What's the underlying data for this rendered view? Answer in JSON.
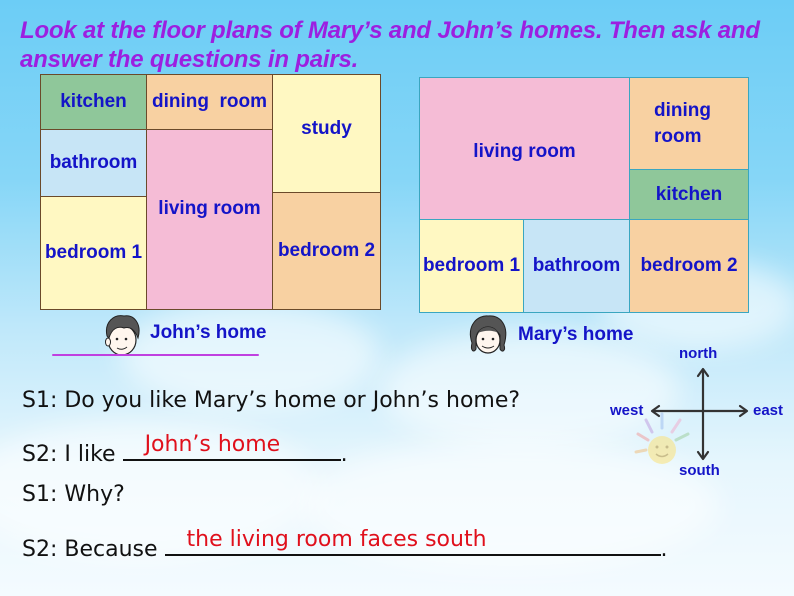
{
  "title": "Look at the floor plans of Mary’s and John’s homes. Then ask and answer the questions in pairs.",
  "john_plan": {
    "caption": "John’s home",
    "rooms": {
      "kitchen": "kitchen",
      "dining_room": "dining  room",
      "study": "study",
      "bathroom": "bathroom",
      "living_room": "living room",
      "bedroom1": "bedroom 1",
      "bedroom2": "bedroom 2"
    }
  },
  "mary_plan": {
    "caption": "Mary’s home",
    "rooms": {
      "living_room": "living room",
      "dining_room_line1": "dining",
      "dining_room_line2": "room",
      "kitchen": "kitchen",
      "bedroom1": "bedroom 1",
      "bathroom": "bathroom",
      "bedroom2": "bedroom 2"
    }
  },
  "compass": {
    "north": "north",
    "south": "south",
    "west": "west",
    "east": "east"
  },
  "dialog": {
    "line1": "S1: Do you like Mary’s home or John’s home?",
    "line2_prefix": "S2: I like ",
    "line2_answer": "John’s home",
    "line2_suffix": ".",
    "line3": "S1: Why?",
    "line4_prefix": "S2: Because ",
    "line4_answer": "the living room faces south",
    "line4_suffix": "."
  },
  "colors": {
    "title": "#9c1fe0",
    "room_label": "#1414c8",
    "answer": "#e0101c"
  }
}
